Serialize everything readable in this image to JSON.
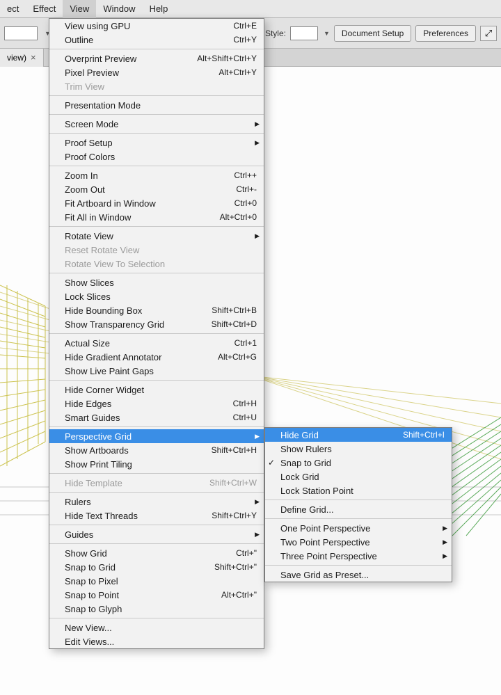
{
  "menu_bar": {
    "items": [
      "ect",
      "Effect",
      "View",
      "Window",
      "Help"
    ],
    "active_index": 2
  },
  "secondary_toolbar": {
    "style_label": "Style:",
    "doc_setup_label": "Document Setup",
    "preferences_label": "Preferences"
  },
  "tab": {
    "name": "view)"
  },
  "view_menu": {
    "groups": [
      [
        {
          "label": "View using GPU",
          "shortcut": "Ctrl+E"
        },
        {
          "label": "Outline",
          "shortcut": "Ctrl+Y"
        }
      ],
      [
        {
          "label": "Overprint Preview",
          "shortcut": "Alt+Shift+Ctrl+Y"
        },
        {
          "label": "Pixel Preview",
          "shortcut": "Alt+Ctrl+Y"
        },
        {
          "label": "Trim View",
          "disabled": true
        }
      ],
      [
        {
          "label": "Presentation Mode"
        }
      ],
      [
        {
          "label": "Screen Mode",
          "submenu": true
        }
      ],
      [
        {
          "label": "Proof Setup",
          "submenu": true
        },
        {
          "label": "Proof Colors"
        }
      ],
      [
        {
          "label": "Zoom In",
          "shortcut": "Ctrl++"
        },
        {
          "label": "Zoom Out",
          "shortcut": "Ctrl+-"
        },
        {
          "label": "Fit Artboard in Window",
          "shortcut": "Ctrl+0"
        },
        {
          "label": "Fit All in Window",
          "shortcut": "Alt+Ctrl+0"
        }
      ],
      [
        {
          "label": "Rotate View",
          "submenu": true
        },
        {
          "label": "Reset Rotate View",
          "disabled": true
        },
        {
          "label": "Rotate View To Selection",
          "disabled": true
        }
      ],
      [
        {
          "label": "Show Slices"
        },
        {
          "label": "Lock Slices"
        },
        {
          "label": "Hide Bounding Box",
          "shortcut": "Shift+Ctrl+B"
        },
        {
          "label": "Show Transparency Grid",
          "shortcut": "Shift+Ctrl+D"
        }
      ],
      [
        {
          "label": "Actual Size",
          "shortcut": "Ctrl+1"
        },
        {
          "label": "Hide Gradient Annotator",
          "shortcut": "Alt+Ctrl+G"
        },
        {
          "label": "Show Live Paint Gaps"
        }
      ],
      [
        {
          "label": "Hide Corner Widget"
        },
        {
          "label": "Hide Edges",
          "shortcut": "Ctrl+H"
        },
        {
          "label": "Smart Guides",
          "shortcut": "Ctrl+U"
        }
      ],
      [
        {
          "label": "Perspective Grid",
          "submenu": true,
          "highlight": true
        },
        {
          "label": "Show Artboards",
          "shortcut": "Shift+Ctrl+H"
        },
        {
          "label": "Show Print Tiling"
        }
      ],
      [
        {
          "label": "Hide Template",
          "shortcut": "Shift+Ctrl+W",
          "disabled": true
        }
      ],
      [
        {
          "label": "Rulers",
          "submenu": true
        },
        {
          "label": "Hide Text Threads",
          "shortcut": "Shift+Ctrl+Y"
        }
      ],
      [
        {
          "label": "Guides",
          "submenu": true
        }
      ],
      [
        {
          "label": "Show Grid",
          "shortcut": "Ctrl+\""
        },
        {
          "label": "Snap to Grid",
          "shortcut": "Shift+Ctrl+\""
        },
        {
          "label": "Snap to Pixel"
        },
        {
          "label": "Snap to Point",
          "shortcut": "Alt+Ctrl+\""
        },
        {
          "label": "Snap to Glyph"
        }
      ],
      [
        {
          "label": "New View..."
        },
        {
          "label": "Edit Views..."
        }
      ]
    ]
  },
  "perspective_submenu": {
    "groups": [
      [
        {
          "label": "Hide Grid",
          "shortcut": "Shift+Ctrl+I",
          "highlight": true
        },
        {
          "label": "Show Rulers"
        },
        {
          "label": "Snap to Grid",
          "checked": true
        },
        {
          "label": "Lock Grid"
        },
        {
          "label": "Lock Station Point"
        }
      ],
      [
        {
          "label": "Define Grid..."
        }
      ],
      [
        {
          "label": "One Point Perspective",
          "submenu": true
        },
        {
          "label": "Two Point Perspective",
          "submenu": true
        },
        {
          "label": "Three Point Perspective",
          "submenu": true
        }
      ],
      [
        {
          "label": "Save Grid as Preset..."
        }
      ]
    ]
  }
}
